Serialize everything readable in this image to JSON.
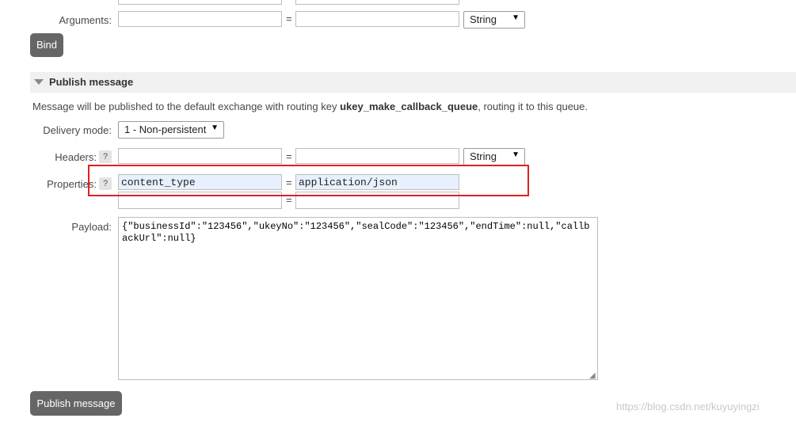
{
  "bind_section": {
    "arguments_label": "Arguments:",
    "eq": "=",
    "arg_type": "String",
    "bind_button": "Bind"
  },
  "publish_section": {
    "title": "Publish message",
    "description_prefix": "Message will be published to the default exchange with routing key ",
    "routing_key": "ukey_make_callback_queue",
    "description_suffix": ", routing it to this queue.",
    "delivery_mode_label": "Delivery mode:",
    "delivery_mode_value": "1 - Non-persistent",
    "headers_label": "Headers:",
    "headers_type": "String",
    "help": "?",
    "properties_label": "Properties:",
    "property_key": "content_type",
    "property_value": "application/json",
    "eq": "=",
    "payload_label": "Payload:",
    "payload": "{\"businessId\":\"123456\",\"ukeyNo\":\"123456\",\"sealCode\":\"123456\",\"endTime\":null,\"callbackUrl\":null}",
    "publish_button": "Publish message"
  },
  "watermark": "https://blog.csdn.net/kuyuyingzi",
  "colors": {
    "button_bg": "#666666",
    "highlight_border": "#e02020",
    "autofill_bg": "#e8f0fe"
  },
  "icons": {
    "collapse": "triangle-down-icon",
    "resize": "resize-grip-icon",
    "dropdown": "caret-down-icon"
  }
}
